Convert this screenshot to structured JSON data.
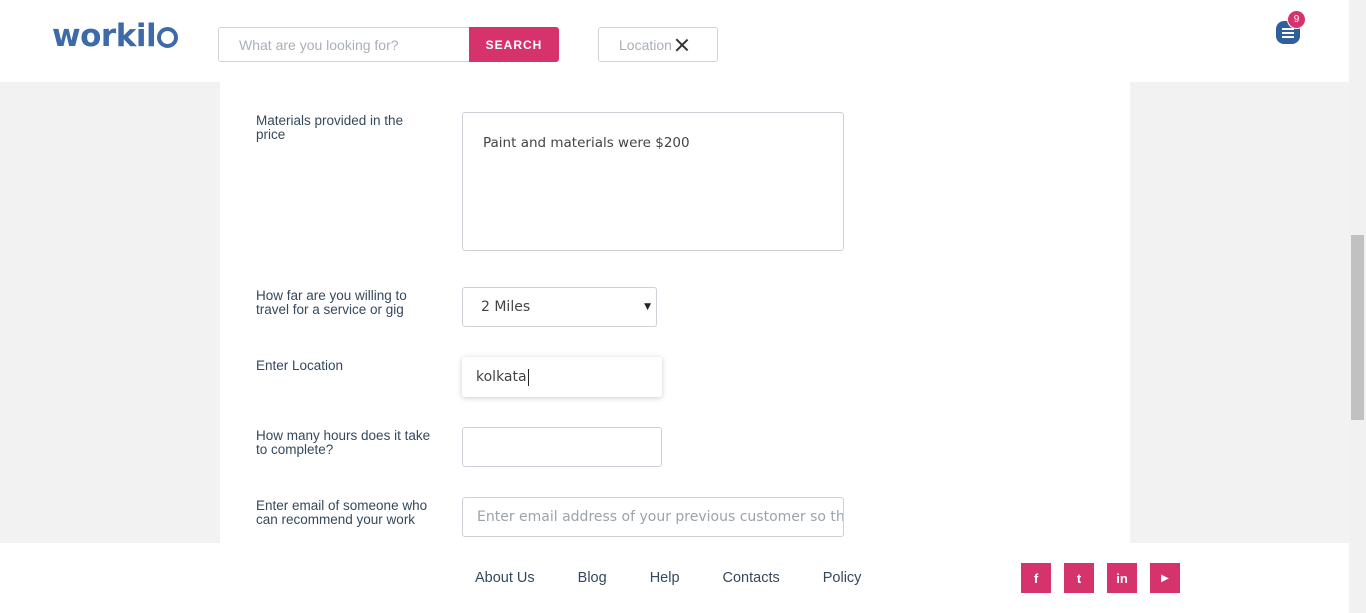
{
  "header": {
    "logo_text": "workil",
    "search": {
      "placeholder": "What are you looking for?",
      "button_label": "SEARCH"
    },
    "location_chip": {
      "label": "Location"
    },
    "messages": {
      "badge_count": "9"
    }
  },
  "form": {
    "materials": {
      "label": "Materials provided in the price",
      "value": "Paint and materials were $200"
    },
    "travel": {
      "label": "How far are you willing to travel for a service or gig",
      "selected": "2 Miles"
    },
    "location": {
      "label": "Enter Location",
      "value": "kolkata"
    },
    "hours": {
      "label": "How many hours does it take to complete?",
      "value": ""
    },
    "email": {
      "label": "Enter email of someone who can recommend your work",
      "placeholder": "Enter email address of your previous customer so that"
    }
  },
  "footer": {
    "links": [
      "About Us",
      "Blog",
      "Help",
      "Contacts",
      "Policy"
    ],
    "socials": [
      "facebook-icon",
      "twitter-icon",
      "linkedin-icon",
      "youtube-icon"
    ],
    "social_glyphs": [
      "f",
      "t",
      "in",
      "▶"
    ]
  },
  "colors": {
    "brand_blue": "#3d6aa8",
    "accent_pink": "#d6336c"
  }
}
